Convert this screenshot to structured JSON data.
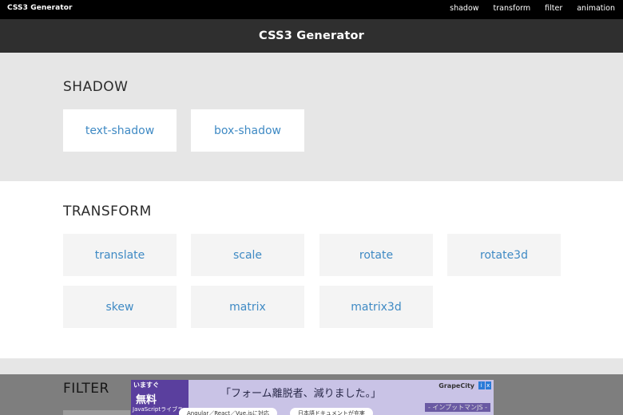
{
  "topbar": {
    "brand": "CSS3 Generator",
    "nav": [
      "shadow",
      "transform",
      "filter",
      "animation"
    ]
  },
  "header": {
    "title": "CSS3 Generator"
  },
  "sections": {
    "shadow": {
      "title": "SHADOW",
      "items": [
        "text-shadow",
        "box-shadow"
      ]
    },
    "transform": {
      "title": "TRANSFORM",
      "items": [
        "translate",
        "scale",
        "rotate",
        "rotate3d",
        "skew",
        "matrix",
        "matrix3d"
      ]
    },
    "filter": {
      "title": "FILTER"
    }
  },
  "ad": {
    "corner_line1": "いますぐ",
    "corner_line2": "無料",
    "corner_line3": "JavaScriptライブラリ",
    "headline": "「フォーム離脱者、減りました。」",
    "brand": "GrapeCity",
    "pill1": "Angular／React／Vue.jsに対応",
    "pill2": "日本語ドキュメントが充実",
    "sub": "- インプットマンJS -",
    "close_i": "i",
    "close_x": "x"
  },
  "colors": {
    "link": "#3f8ac4",
    "topbar_bg": "#000000",
    "titlebar_bg": "#2f2f2f",
    "band_grey": "#e6e6e6"
  }
}
